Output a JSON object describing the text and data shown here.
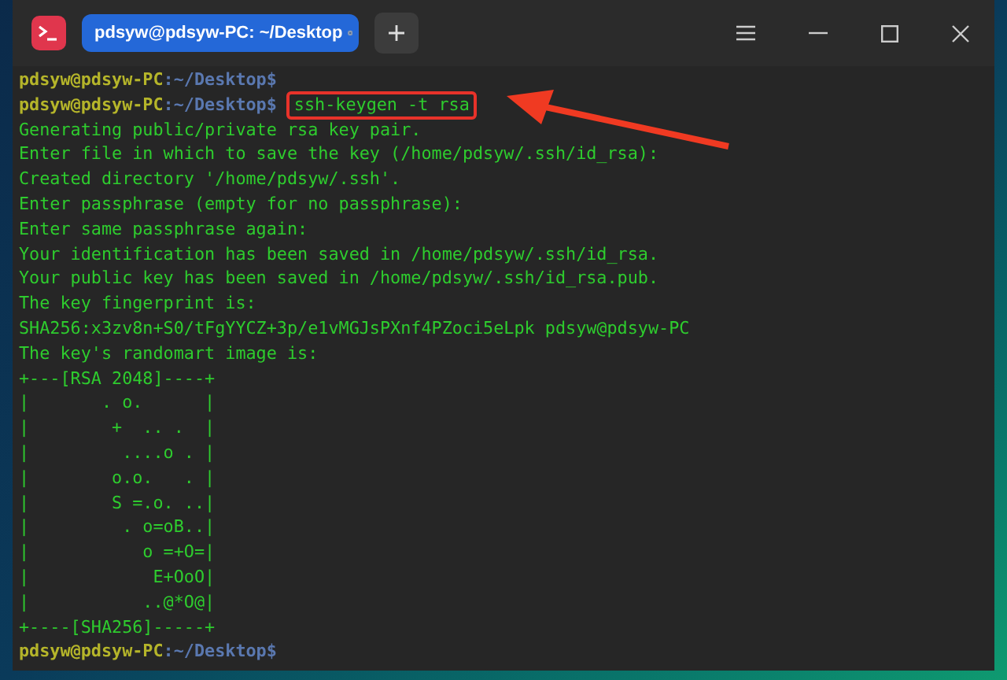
{
  "tab": {
    "title": "pdsyw@pdsyw-PC: ~/Desktop",
    "selected": true
  },
  "lines": [
    {
      "kind": "prompt",
      "user": "pdsyw@pdsyw-PC",
      "path": ":~/Desktop$"
    },
    {
      "kind": "prompt",
      "user": "pdsyw@pdsyw-PC",
      "path": ":~/Desktop$",
      "command": "ssh-keygen -t rsa",
      "highlighted": true
    },
    {
      "kind": "output",
      "text": "Generating public/private rsa key pair."
    },
    {
      "kind": "output",
      "text": "Enter file in which to save the key (/home/pdsyw/.ssh/id_rsa):"
    },
    {
      "kind": "output",
      "text": "Created directory '/home/pdsyw/.ssh'."
    },
    {
      "kind": "output",
      "text": "Enter passphrase (empty for no passphrase):"
    },
    {
      "kind": "output",
      "text": "Enter same passphrase again:"
    },
    {
      "kind": "output",
      "text": "Your identification has been saved in /home/pdsyw/.ssh/id_rsa."
    },
    {
      "kind": "output",
      "text": "Your public key has been saved in /home/pdsyw/.ssh/id_rsa.pub."
    },
    {
      "kind": "output",
      "text": "The key fingerprint is:"
    },
    {
      "kind": "output",
      "text": "SHA256:x3zv8n+S0/tFgYYCZ+3p/e1vMGJsPXnf4PZoci5eLpk pdsyw@pdsyw-PC"
    },
    {
      "kind": "output",
      "text": "The key's randomart image is:"
    },
    {
      "kind": "output",
      "text": "+---[RSA 2048]----+"
    },
    {
      "kind": "output",
      "text": "|       . o.      |"
    },
    {
      "kind": "output",
      "text": "|        +  .. .  |"
    },
    {
      "kind": "output",
      "text": "|         ....o . |"
    },
    {
      "kind": "output",
      "text": "|        o.o.   . |"
    },
    {
      "kind": "output",
      "text": "|        S =.o. ..|"
    },
    {
      "kind": "output",
      "text": "|         . o=oB..|"
    },
    {
      "kind": "output",
      "text": "|           o =+O=|"
    },
    {
      "kind": "output",
      "text": "|            E+OoO|"
    },
    {
      "kind": "output",
      "text": "|           ..@*O@|"
    },
    {
      "kind": "output",
      "text": "+----[SHA256]-----+"
    },
    {
      "kind": "prompt",
      "user": "pdsyw@pdsyw-PC",
      "path": ":~/Desktop$"
    }
  ]
}
